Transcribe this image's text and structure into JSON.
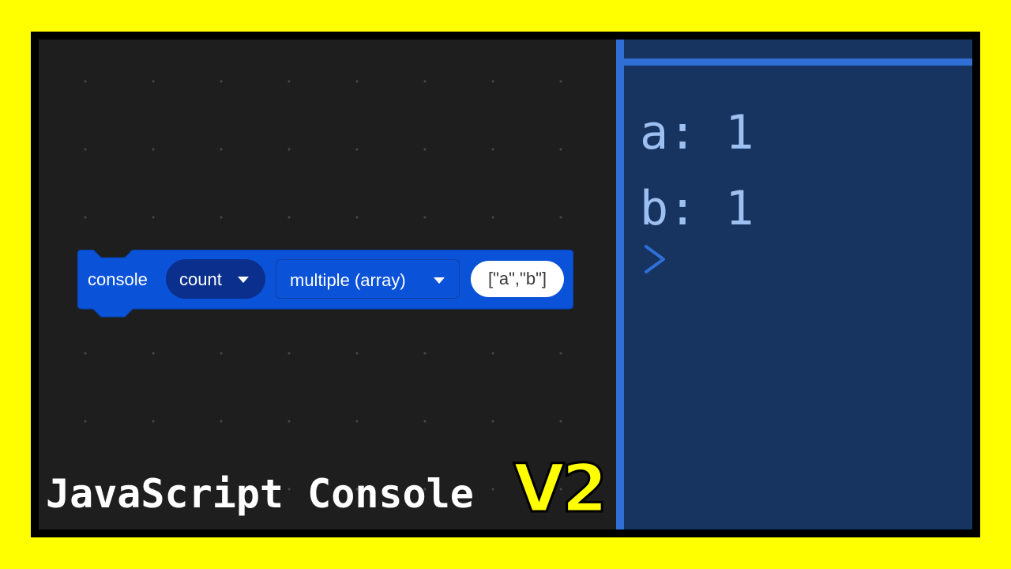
{
  "block": {
    "label": "console",
    "method_dropdown": "count",
    "mode_dropdown": "multiple (array)",
    "value_input": "[\"a\",\"b\"]"
  },
  "console": {
    "lines": [
      "a: 1",
      "b: 1"
    ],
    "prompt_icon": "chevron-right-icon"
  },
  "title": {
    "main": "JavaScript Console",
    "badge": "V2"
  },
  "colors": {
    "background_yellow": "#ffff00",
    "workspace_bg": "#1e1e1e",
    "console_bg": "#17335f",
    "console_accent": "#2f6fd6",
    "console_text": "#9dc0f2",
    "block_blue": "#0a52d8"
  }
}
